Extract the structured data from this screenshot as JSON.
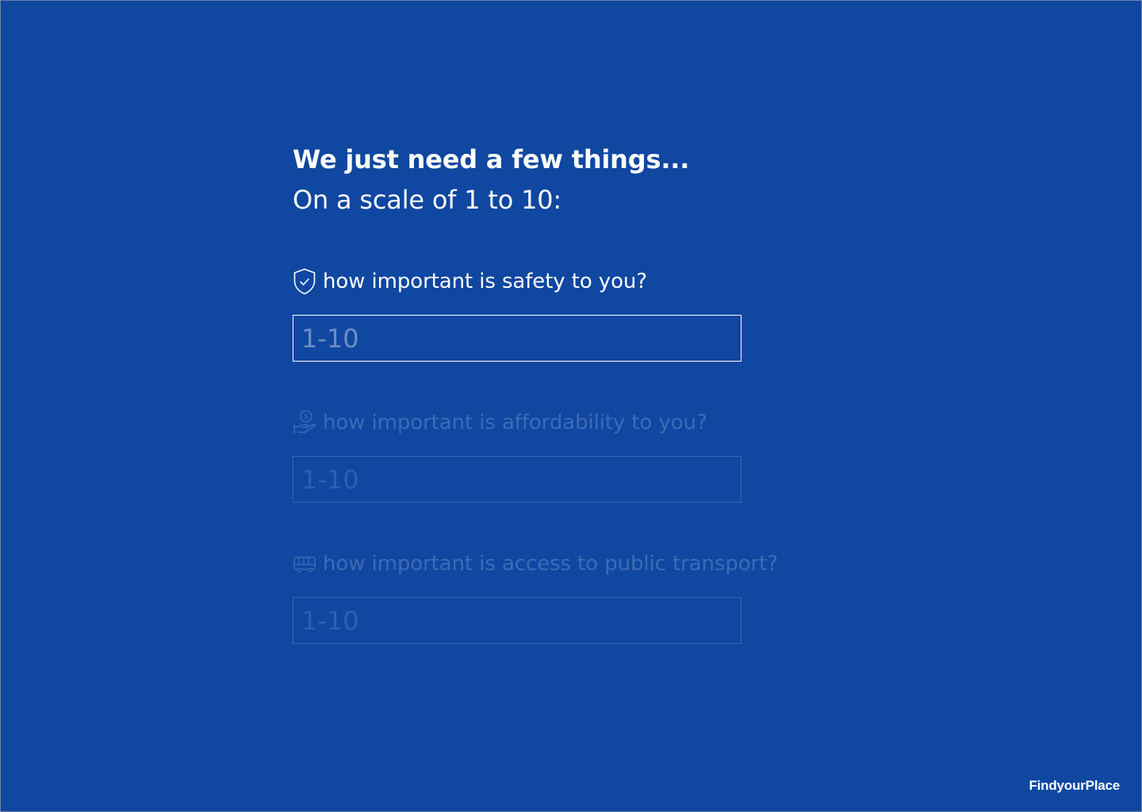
{
  "header": {
    "title": "We just need a few things...",
    "subtitle": "On a scale of 1 to 10:"
  },
  "questions": [
    {
      "icon": "shield-check-icon",
      "label": "how important is safety to you?",
      "placeholder": "1-10",
      "value": "",
      "state": "active"
    },
    {
      "icon": "hand-coin-icon",
      "label": "how important is affordability to you?",
      "placeholder": "1-10",
      "value": "",
      "state": "disabled"
    },
    {
      "icon": "bus-icon",
      "label": "how important is access to public transport?",
      "placeholder": "1-10",
      "value": "",
      "state": "disabled"
    }
  ],
  "brand": {
    "name": "FindyourPlace"
  },
  "colors": {
    "background": "#0f47a1",
    "text": "#ffffff",
    "dimmed_text": "#3e6bb6",
    "placeholder": "#6f8dc4"
  }
}
